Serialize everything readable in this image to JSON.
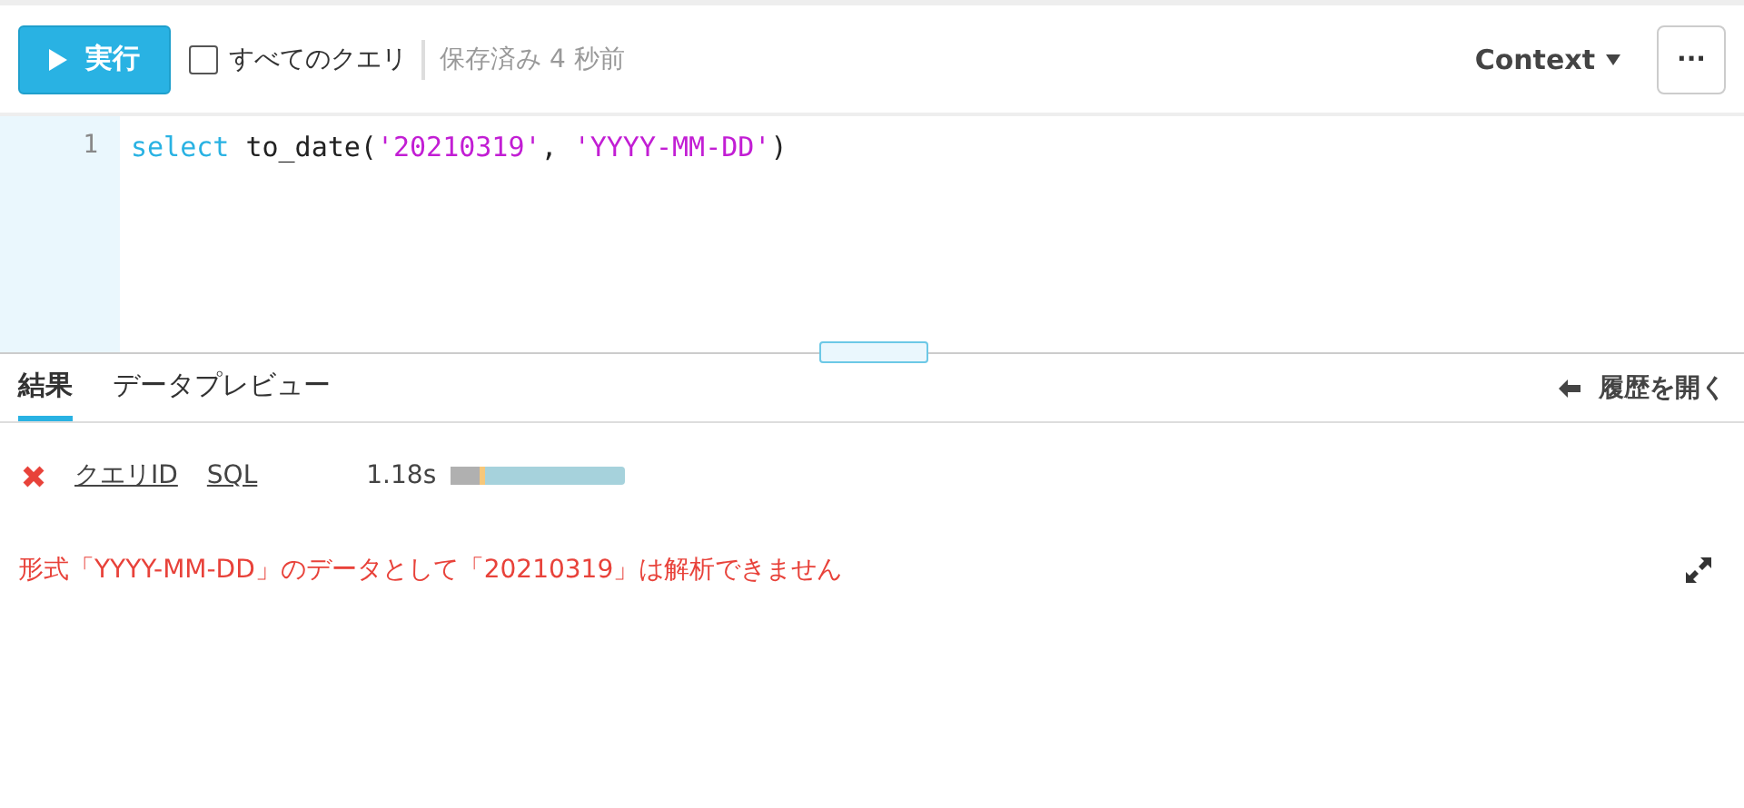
{
  "toolbar": {
    "run_button": "実行",
    "all_queries": {
      "label": "すべてのクエリ",
      "checked": false
    },
    "saved_status": "保存済み 4 秒前",
    "context_menu": "Context",
    "more_button": "···"
  },
  "editor": {
    "lines": [
      {
        "number": "1",
        "tokens": [
          {
            "kind": "keyword",
            "text": "select"
          },
          {
            "kind": "plain",
            "text": " to_date("
          },
          {
            "kind": "string",
            "text": "'20210319'"
          },
          {
            "kind": "plain",
            "text": ", "
          },
          {
            "kind": "string",
            "text": "'YYYY-MM-DD'"
          },
          {
            "kind": "plain",
            "text": ")"
          }
        ]
      }
    ]
  },
  "tabs": [
    {
      "label": "結果",
      "selected": true
    },
    {
      "label": "データプレビュー",
      "selected": false
    }
  ],
  "history_button": "履歴を開く",
  "result": {
    "failed": true,
    "query_id": "クエリID",
    "sql": "SQL",
    "duration": "1.18s"
  },
  "error_message": "形式「YYYY-MM-DD」のデータとして「20210319」は解析できません"
}
